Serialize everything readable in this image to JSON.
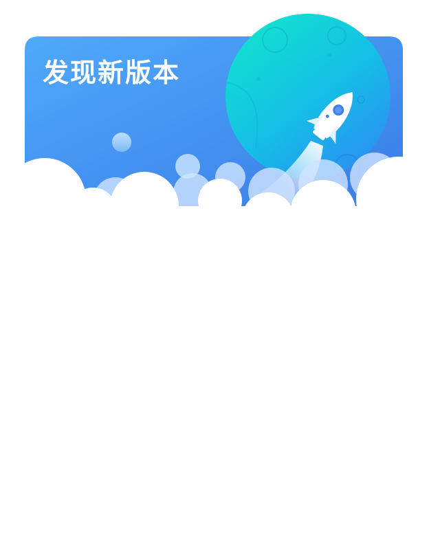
{
  "dialog": {
    "title": "发现新版本"
  },
  "colors": {
    "banner_gradient_start": "#4fa9fb",
    "banner_gradient_end": "#3a7be6",
    "planet_gradient_start": "#12e2cf",
    "planet_gradient_end": "#2b8ff4",
    "title_text": "#ffffff",
    "body_background": "#ffffff"
  },
  "icons": {
    "rocket": "rocket-icon",
    "planet": "planet-illustration",
    "clouds": "clouds-illustration"
  }
}
